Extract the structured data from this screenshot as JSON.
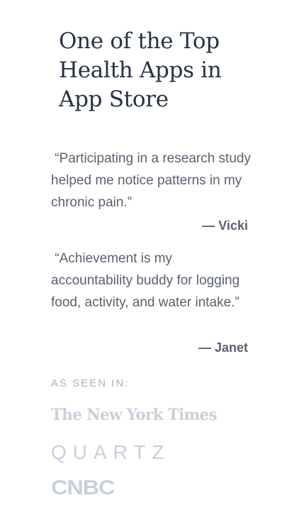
{
  "headline": "One of the Top Health Apps in App Store",
  "testimonials": [
    {
      "quote": " “Participating in a research study helped me notice patterns in my chronic pain.”",
      "author": "— Vicki"
    },
    {
      "quote": " “Achievement is my accountability buddy for logging food, activity, and water intake.”",
      "author": "— Janet"
    }
  ],
  "press": {
    "label": "AS SEEN IN:",
    "logos": [
      {
        "name": "The New York Times"
      },
      {
        "name": "QUARTZ"
      },
      {
        "name": "CNBC"
      }
    ]
  }
}
